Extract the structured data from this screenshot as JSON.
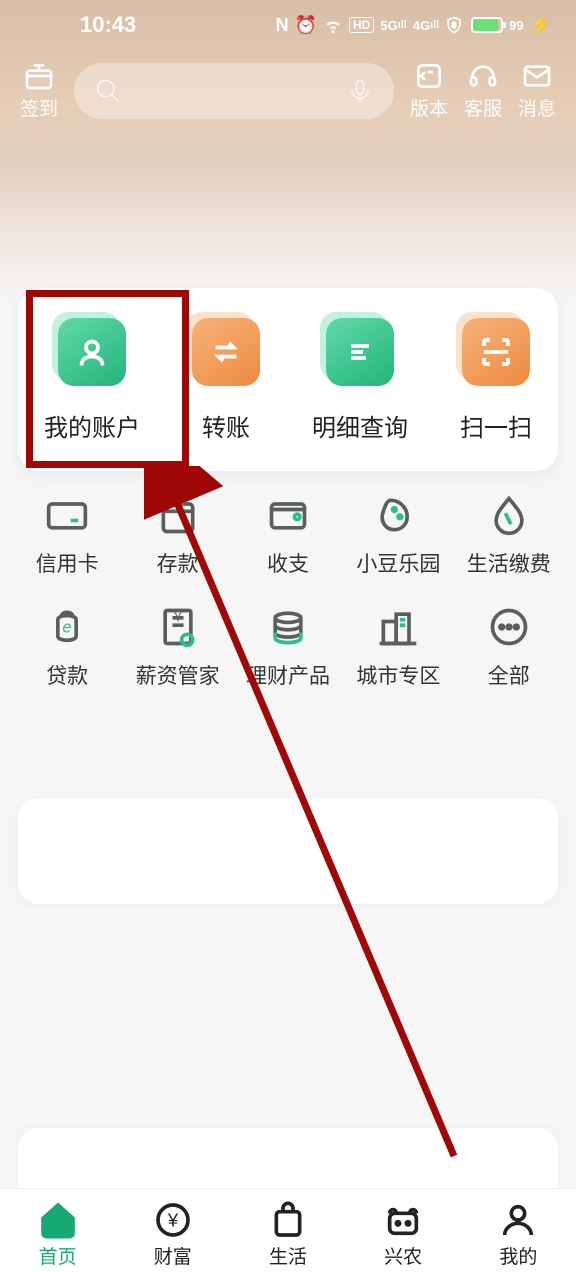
{
  "status": {
    "time": "10:43",
    "battery": "99"
  },
  "topbar": {
    "checkin": "签到",
    "version": "版本",
    "service": "客服",
    "message": "消息"
  },
  "main": {
    "account": "我的账户",
    "transfer": "转账",
    "detail": "明细查询",
    "scan": "扫一扫"
  },
  "grid": {
    "r1": {
      "a": "信用卡",
      "b": "存款",
      "c": "收支",
      "d": "小豆乐园",
      "e": "生活缴费"
    },
    "r2": {
      "a": "贷款",
      "b": "薪资管家",
      "c": "理财产品",
      "d": "城市专区",
      "e": "全部"
    }
  },
  "nav": {
    "home": "首页",
    "wealth": "财富",
    "life": "生活",
    "agri": "兴农",
    "mine": "我的"
  }
}
